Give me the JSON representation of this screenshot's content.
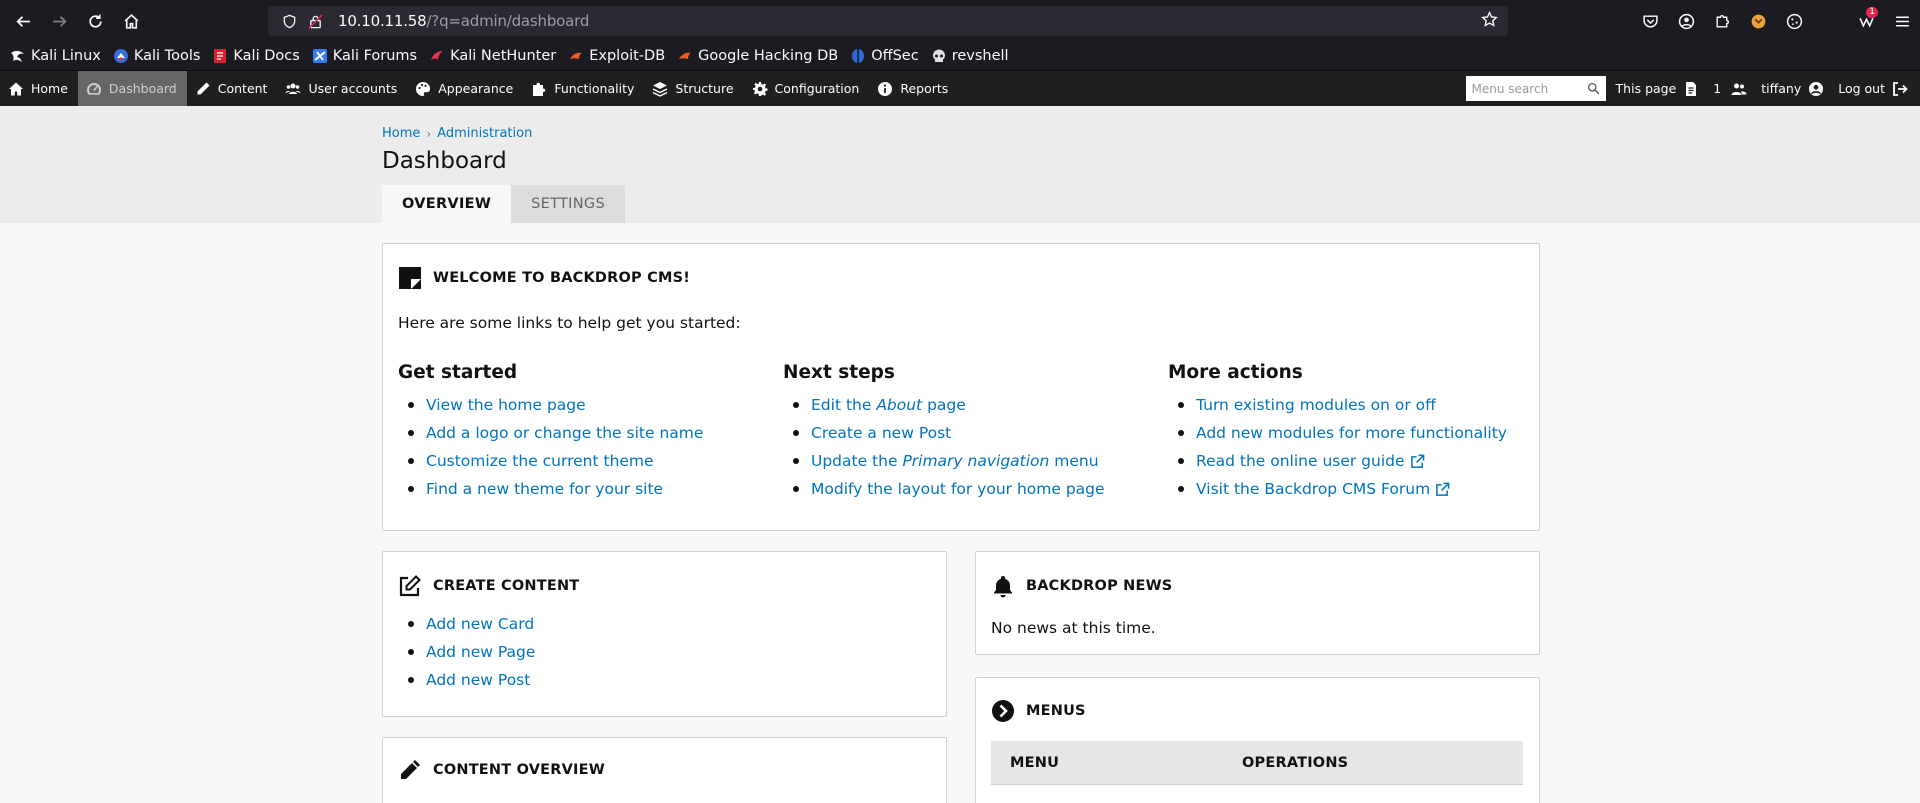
{
  "browser": {
    "url_host": "10.10.11.58",
    "url_path": "/?q=admin/dashboard",
    "notification_count": "1",
    "bookmarks": [
      {
        "label": "Kali Linux",
        "icon": "kali-dragon-icon"
      },
      {
        "label": "Kali Tools",
        "icon": "kali-tools-icon"
      },
      {
        "label": "Kali Docs",
        "icon": "kali-docs-icon"
      },
      {
        "label": "Kali Forums",
        "icon": "kali-forums-icon"
      },
      {
        "label": "Kali NetHunter",
        "icon": "kali-nethunter-icon"
      },
      {
        "label": "Exploit-DB",
        "icon": "exploit-db-icon"
      },
      {
        "label": "Google Hacking DB",
        "icon": "google-hacking-db-icon"
      },
      {
        "label": "OffSec",
        "icon": "offsec-icon"
      },
      {
        "label": "revshell",
        "icon": "skull-icon"
      }
    ]
  },
  "admin_bar": {
    "items": [
      {
        "label": "Home",
        "icon": "home-icon"
      },
      {
        "label": "Dashboard",
        "icon": "dashboard-icon"
      },
      {
        "label": "Content",
        "icon": "pencil-icon"
      },
      {
        "label": "User accounts",
        "icon": "users-icon"
      },
      {
        "label": "Appearance",
        "icon": "palette-icon"
      },
      {
        "label": "Functionality",
        "icon": "puzzle-icon"
      },
      {
        "label": "Structure",
        "icon": "layers-icon"
      },
      {
        "label": "Configuration",
        "icon": "gear-icon"
      },
      {
        "label": "Reports",
        "icon": "info-icon"
      }
    ],
    "search_placeholder": "Menu search",
    "this_page": "This page",
    "user_count": "1",
    "username": "tiffany",
    "logout": "Log out"
  },
  "header": {
    "breadcrumb": [
      "Home",
      "Administration"
    ],
    "title": "Dashboard",
    "tabs": [
      "OVERVIEW",
      "SETTINGS"
    ]
  },
  "welcome": {
    "title": "WELCOME TO BACKDROP CMS!",
    "intro": "Here are some links to help get you started:",
    "get_started": {
      "heading": "Get started",
      "links": [
        "View the home page",
        "Add a logo or change the site name",
        "Customize the current theme",
        "Find a new theme for your site"
      ]
    },
    "next_steps": {
      "heading": "Next steps",
      "link1_pre": "Edit the ",
      "link1_em": "About",
      "link1_post": " page",
      "link2": "Create a new Post",
      "link3_pre": "Update the ",
      "link3_em": "Primary navigation",
      "link3_post": " menu",
      "link4": "Modify the layout for your home page"
    },
    "more_actions": {
      "heading": "More actions",
      "links": [
        "Turn existing modules on or off",
        "Add new modules for more functionality",
        "Read the online user guide",
        "Visit the Backdrop CMS Forum"
      ]
    }
  },
  "create_content": {
    "title": "CREATE CONTENT",
    "links": [
      "Add new Card",
      "Add new Page",
      "Add new Post"
    ]
  },
  "news": {
    "title": "BACKDROP NEWS",
    "text": "No news at this time."
  },
  "menus": {
    "title": "MENUS",
    "col_menu": "MENU",
    "col_operations": "OPERATIONS"
  },
  "content_overview": {
    "title": "CONTENT OVERVIEW"
  }
}
